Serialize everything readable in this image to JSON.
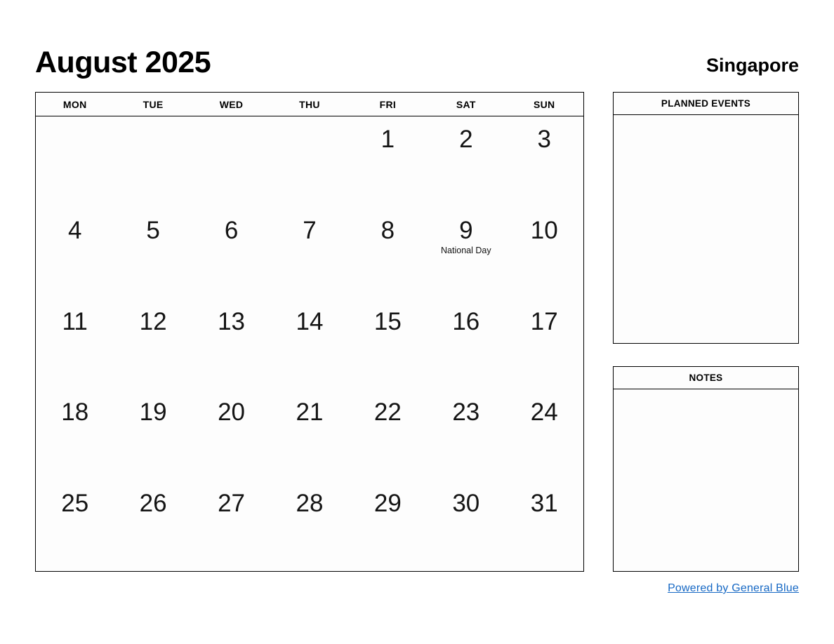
{
  "header": {
    "month_title": "August 2025",
    "region": "Singapore"
  },
  "calendar": {
    "weekdays": [
      "MON",
      "TUE",
      "WED",
      "THU",
      "FRI",
      "SAT",
      "SUN"
    ],
    "weeks": [
      [
        {
          "day": ""
        },
        {
          "day": ""
        },
        {
          "day": ""
        },
        {
          "day": ""
        },
        {
          "day": "1"
        },
        {
          "day": "2"
        },
        {
          "day": "3"
        }
      ],
      [
        {
          "day": "4"
        },
        {
          "day": "5"
        },
        {
          "day": "6"
        },
        {
          "day": "7"
        },
        {
          "day": "8"
        },
        {
          "day": "9",
          "event": "National Day"
        },
        {
          "day": "10"
        }
      ],
      [
        {
          "day": "11"
        },
        {
          "day": "12"
        },
        {
          "day": "13"
        },
        {
          "day": "14"
        },
        {
          "day": "15"
        },
        {
          "day": "16"
        },
        {
          "day": "17"
        }
      ],
      [
        {
          "day": "18"
        },
        {
          "day": "19"
        },
        {
          "day": "20"
        },
        {
          "day": "21"
        },
        {
          "day": "22"
        },
        {
          "day": "23"
        },
        {
          "day": "24"
        }
      ],
      [
        {
          "day": "25"
        },
        {
          "day": "26"
        },
        {
          "day": "27"
        },
        {
          "day": "28"
        },
        {
          "day": "29"
        },
        {
          "day": "30"
        },
        {
          "day": "31"
        }
      ]
    ]
  },
  "panels": {
    "planned_events_title": "PLANNED EVENTS",
    "notes_title": "NOTES"
  },
  "footer": {
    "link_text": "Powered by General Blue",
    "link_color": "#1668c4"
  }
}
